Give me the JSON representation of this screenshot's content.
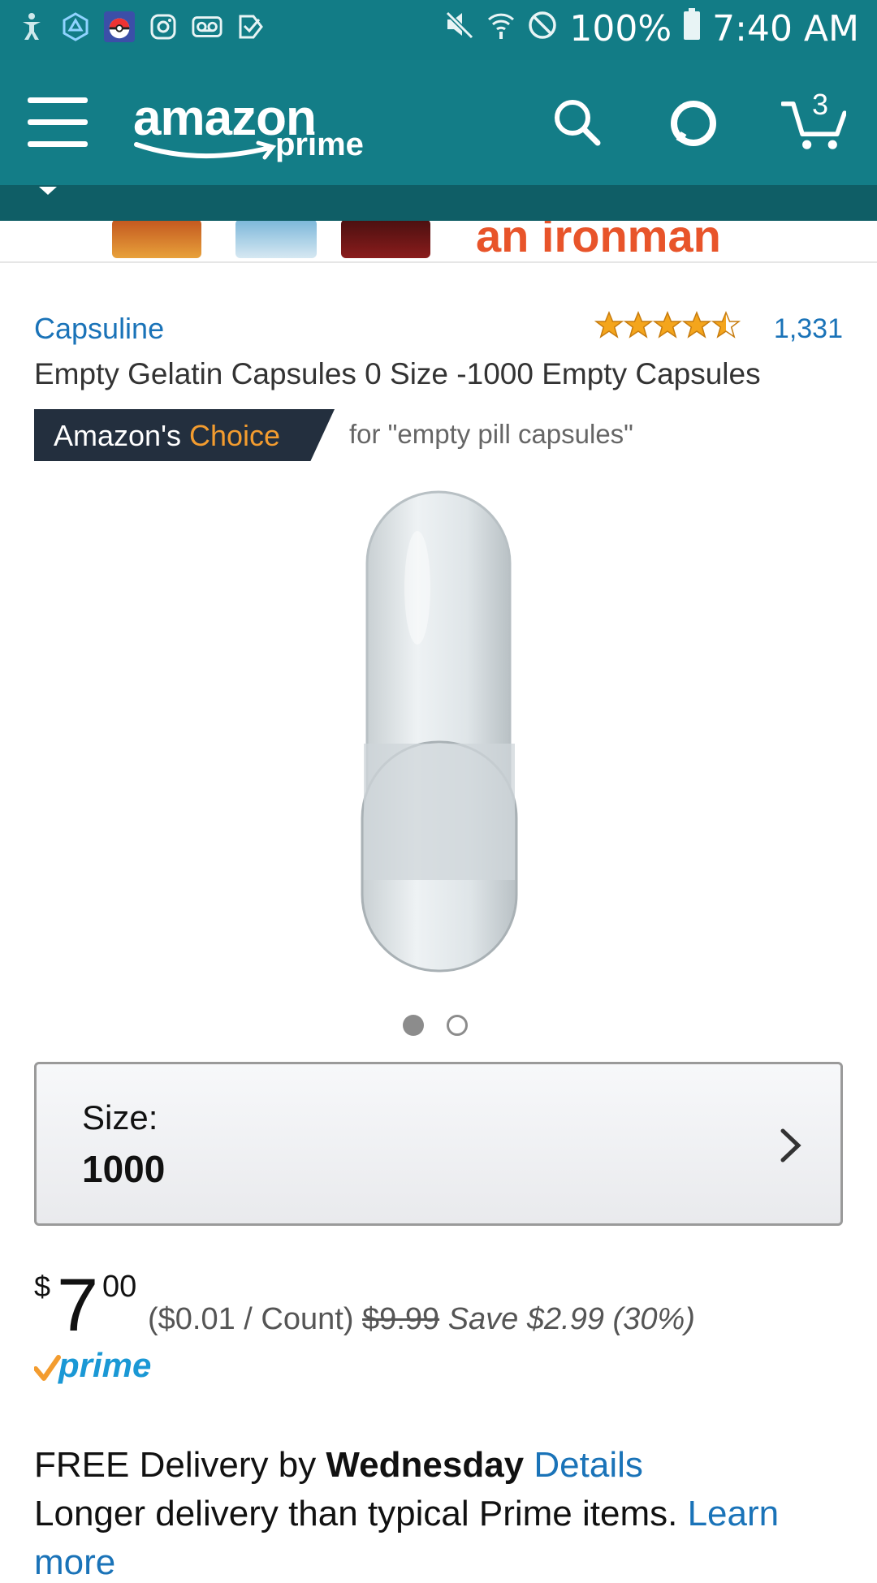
{
  "status_bar": {
    "left_icons": [
      "accessibility-icon",
      "ingress-icon",
      "pokeball-icon",
      "instagram-icon",
      "voicemail-icon",
      "checkmark-icon"
    ],
    "battery": "100%",
    "time": "7:40 AM"
  },
  "app_bar": {
    "logo_word": "amazon",
    "logo_sub": "prime",
    "cart_count": "3",
    "colors": {
      "bar": "#137D87"
    }
  },
  "banner": {
    "text": "an ironman"
  },
  "product": {
    "brand": "Capsuline",
    "rating_count": "1,331",
    "rating_stars": 4.5,
    "title": "Empty Gelatin Capsules 0 Size -1000 Empty Capsules",
    "choice_prefix": "Amazon's ",
    "choice_word": "Choice",
    "choice_for": "for \"empty pill capsules\"",
    "image_index": 1,
    "image_count": 2
  },
  "size_selector": {
    "label": "Size:",
    "value": "1000"
  },
  "price": {
    "currency": "$",
    "whole": "7",
    "fraction": "00",
    "unit_price": "($0.01 / Count)",
    "list_price": "$9.99",
    "savings": "Save $2.99 (30%)",
    "prime_label": "prime"
  },
  "delivery": {
    "prefix": "FREE Delivery by ",
    "day": "Wednesday",
    "details_link": "Details",
    "note": "Longer delivery than typical Prime items.",
    "learn_link": "Learn",
    "more_link": "more"
  }
}
